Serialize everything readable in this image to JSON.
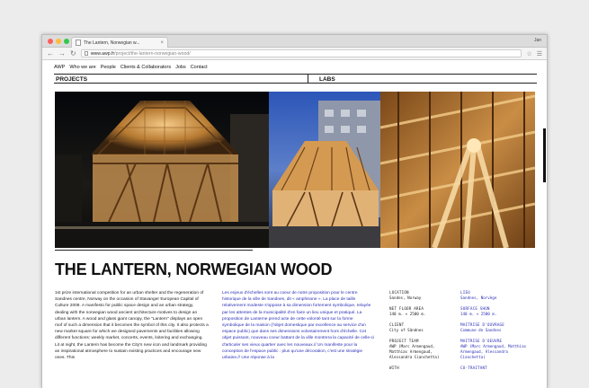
{
  "browser": {
    "tab_title": "The Lantern, Norwegian w...",
    "tab_close": "×",
    "user_label": "Jan",
    "url_host": "www.awp.fr",
    "url_path": "/project/the-lantern-norwegian-wood/",
    "traffic_lights": [
      "#fc605c",
      "#fdbc40",
      "#34c84a"
    ]
  },
  "nav": {
    "items": [
      "AWP",
      "Who we are",
      "People",
      "Clients & Collaborators",
      "Jobs",
      "Contact"
    ]
  },
  "sections": {
    "projects": "PROJECTS",
    "labs": "LABS"
  },
  "project": {
    "title": "THE LANTERN, NORWEGIAN WOOD",
    "description_en": "1st prize international competition for an urban shelter and the regeneration of Sandnes centre, Norway on the occasion of Stavanger European Capital of Culture 2008. A manifesto for public space design and an urban strategy, dealing with the norwegian wood ancient architecture motives to design an urban lantern. A wood and glass giant canopy, the \"Lantern\" displays an open roof of such a dimension that it becomes the symbol of this city. It also protects a new market square for which we designed pavements and facilities allowing different functions: weekly market, concerts, events, loitering and exchanging. Lit at night, the Lantern has become the City's new icon and landmark providing an inspirational atmosphere to sustain existing practices and encourage new ones. This",
    "description_fr": "Les enjeux d'échelles sont au coeur de notre proposition pour le centre historique de la ville de Sandnes, dit « amphisone ». La place de taille relativement modeste s'oppose à sa dimension fortement symbolique, relayée par les attentes de la municipalité d'en faire un lieu unique et pratiqué. La proposition de Lanterne prend acte de cette volonté tant sur la forme symbolique de la maison (l'objet domestique par excellence au service d'un espace public) que dans ses dimensions volontairement hors d'échelle. Cet objet puissant, nouveau coeur battant de la ville montrera la capacité de celle-ci d'articuler ses vieux quartier avec les nouveaux.// Un manifeste pour la conception de l'espace public : plus qu'une décoration, c'est une stratégie urbaine.// Une réponse à la",
    "meta_en": [
      {
        "label": "LOCATION",
        "value": "Sandes, Norway"
      },
      {
        "label": "NET FLOOR AREA",
        "value": "140 m. × 2500 m."
      },
      {
        "label": "CLIENT",
        "value": "City of Sândnes"
      },
      {
        "label": "PROJECT TEAM",
        "value": "AWP (Marc Armengaud, Matthias Armengaud, Alessandra Cianchetta)"
      },
      {
        "label": "WITH",
        "value": ""
      }
    ],
    "meta_fr": [
      {
        "label": "LIEU",
        "value": "Sandnes, Norvège"
      },
      {
        "label": "SURFACE SHON",
        "value": "140 m. × 2500 m."
      },
      {
        "label": "MAITRISE D'OUVRAGE",
        "value": "Commune de Sandnes"
      },
      {
        "label": "MAITRISE D'OEUVRE",
        "value": "AWP (Marc Armengaud, Matthias Armengaud, Alessandra Cianchetta)"
      },
      {
        "label": "CO-TRAITANT",
        "value": ""
      }
    ]
  },
  "colors": {
    "accent_blue": "#2b2fb6",
    "text": "#222222"
  }
}
